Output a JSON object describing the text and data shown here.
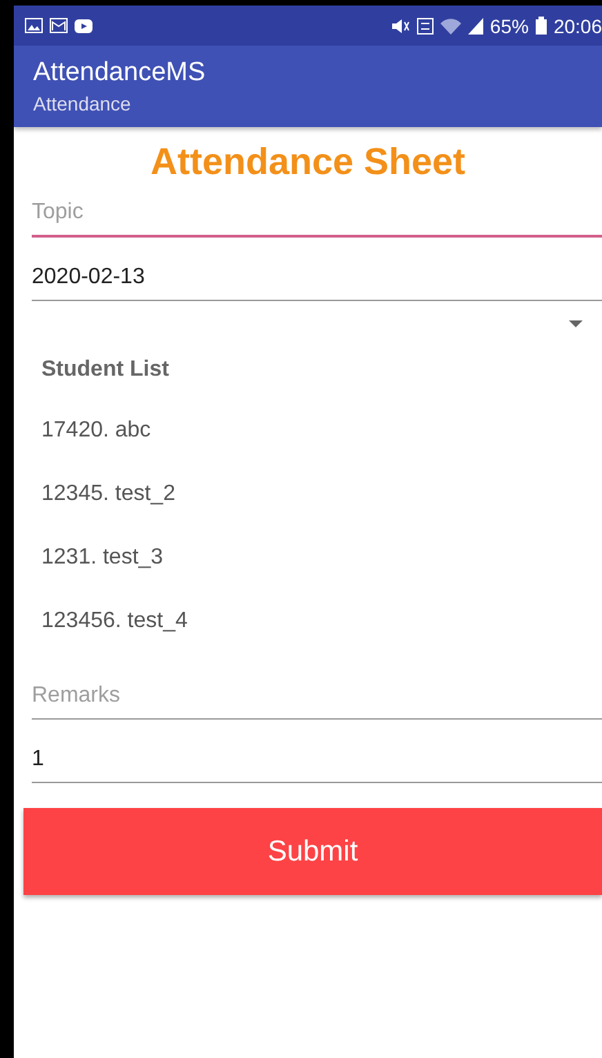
{
  "status_bar": {
    "battery": "65%",
    "time": "20:06"
  },
  "app_bar": {
    "title": "AttendanceMS",
    "subtitle": "Attendance"
  },
  "heading": "Attendance Sheet",
  "topic_field": {
    "placeholder": "Topic",
    "focused": true
  },
  "date_field": {
    "value": "2020-02-13"
  },
  "student_list": {
    "title": "Student List",
    "items": [
      {
        "label": "17420. abc"
      },
      {
        "label": "12345. test_2"
      },
      {
        "label": "1231. test_3"
      },
      {
        "label": "123456. test_4"
      }
    ]
  },
  "remarks_field": {
    "placeholder": "Remarks",
    "focused": false
  },
  "value_field": {
    "value": "1"
  },
  "submit_button": {
    "label": "Submit"
  }
}
